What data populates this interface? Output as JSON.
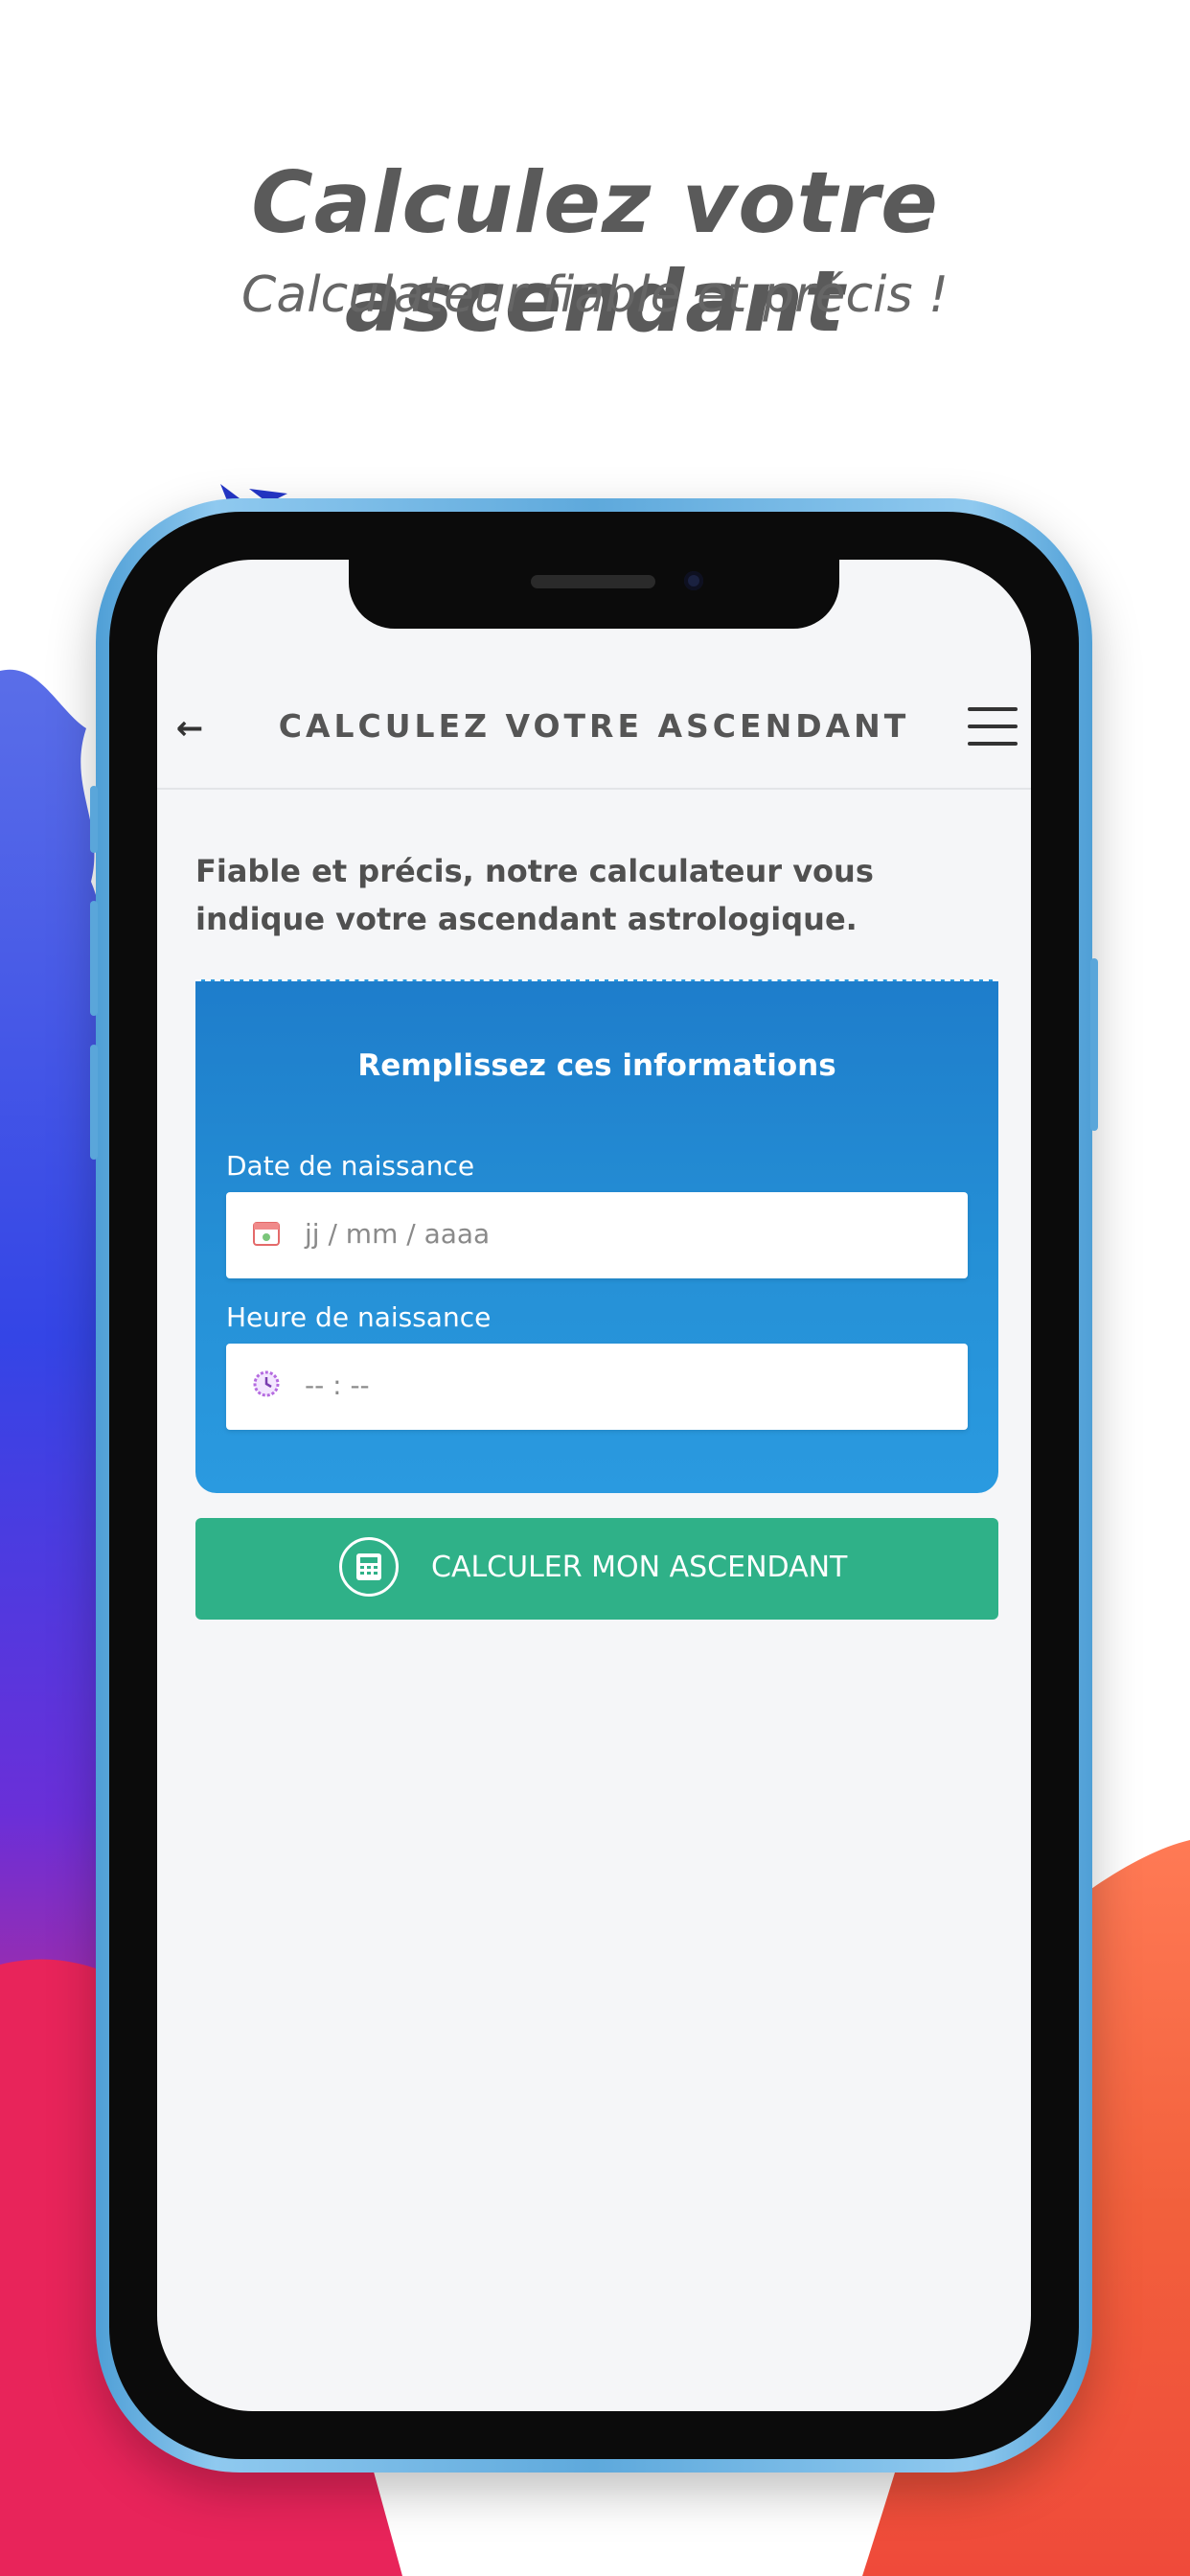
{
  "promo": {
    "title": "Calculez votre ascendant",
    "subtitle": "Calculateur fiable et précis !"
  },
  "app_header": {
    "title": "CALCULEZ VOTRE ASCENDANT",
    "back_icon": "back-arrow-icon",
    "menu_icon": "hamburger-menu-icon"
  },
  "intro_text": "Fiable et précis, notre calculateur vous indique votre ascendant astrologique.",
  "form": {
    "heading": "Remplissez ces informations",
    "birth_date": {
      "label": "Date de naissance",
      "placeholder": "jj / mm / aaaa",
      "icon": "calendar-icon"
    },
    "birth_time": {
      "label": "Heure de naissance",
      "placeholder": "-- : --",
      "icon": "clock-icon"
    }
  },
  "calculate_button": {
    "label": "CALCULER MON ASCENDANT",
    "icon": "calculator-icon"
  },
  "colors": {
    "form_card": "#1e7dcb",
    "button": "#2fb188",
    "phone_frame": "#5ea9dc",
    "paint_blue": "#3d4fe0",
    "paint_pink": "#e8245a",
    "paint_orange": "#ef5a3a"
  }
}
